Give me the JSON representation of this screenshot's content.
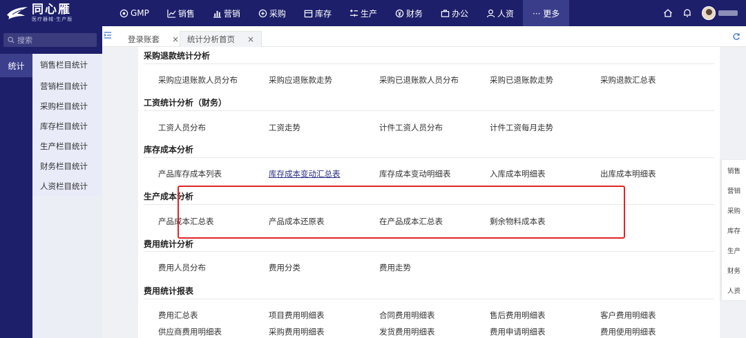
{
  "brand": {
    "name": "同心雁",
    "tagline": "医疗器械·生产版"
  },
  "nav": [
    {
      "label": "GMP",
      "icon": "gmp-icon"
    },
    {
      "label": "销售",
      "icon": "chart-icon"
    },
    {
      "label": "营销",
      "icon": "bar-icon"
    },
    {
      "label": "采购",
      "icon": "cart-icon"
    },
    {
      "label": "库存",
      "icon": "box-icon"
    },
    {
      "label": "生产",
      "icon": "factory-icon"
    },
    {
      "label": "财务",
      "icon": "money-icon"
    },
    {
      "label": "办公",
      "icon": "briefcase-icon"
    },
    {
      "label": "人资",
      "icon": "user-icon"
    },
    {
      "label": "··· 更多",
      "icon": "more-icon"
    }
  ],
  "sidebar": {
    "search_placeholder": "搜索",
    "category": "统计",
    "items": [
      "销售栏目统计",
      "营销栏目统计",
      "采购栏目统计",
      "库存栏目统计",
      "生产栏目统计",
      "财务栏目统计",
      "人资栏目统计"
    ]
  },
  "tabs": [
    {
      "label": "登录账套",
      "close": "×"
    },
    {
      "label": "统计分析首页",
      "close": "×"
    }
  ],
  "sections": [
    {
      "title": "采购退款统计分析",
      "links": [
        "采购应退账款人员分布",
        "采购应退账款走势",
        "采购已退账款人员分布",
        "采购已退账款走势",
        "采购退款汇总表"
      ]
    },
    {
      "title": "工资统计分析（财务）",
      "links": [
        "工资人员分布",
        "工资走势",
        "计件工资人员分布",
        "计件工资每月走势"
      ]
    },
    {
      "title": "库存成本分析",
      "links": [
        "产品库存成本列表",
        "库存成本变动汇总表",
        "库存成本变动明细表",
        "入库成本明细表",
        "出库成本明细表"
      ]
    },
    {
      "title": "生产成本分析",
      "links": [
        "产品成本汇总表",
        "产品成本还原表",
        "在产品成本汇总表",
        "剩余物料成本表"
      ]
    },
    {
      "title": "费用统计分析",
      "links": [
        "费用人员分布",
        "费用分类",
        "费用走势"
      ]
    },
    {
      "title": "费用统计报表",
      "links": [
        "费用汇总表",
        "项目费用明细表",
        "合同费用明细表",
        "售后费用明细表",
        "客户费用明细表",
        "供应商费用明细表",
        "采购费用明细表",
        "发货费用明细表",
        "费用申请明细表",
        "费用使用明细表"
      ]
    }
  ],
  "right_menu": [
    "销售",
    "营销",
    "采购",
    "库存",
    "生产",
    "财务",
    "人资"
  ]
}
